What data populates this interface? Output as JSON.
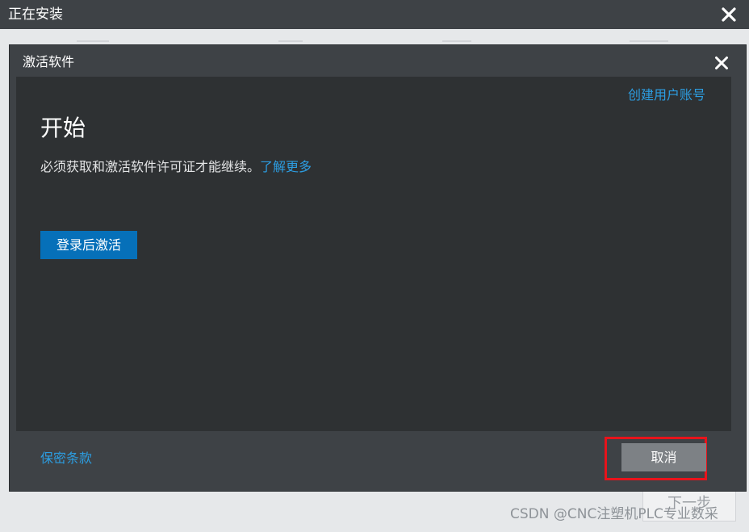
{
  "outer_window": {
    "title": "正在安装",
    "next_button_label": "下一步"
  },
  "dialog": {
    "title": "激活软件",
    "create_account_link": "创建用户账号",
    "heading": "开始",
    "description": "必须获取和激活软件许可证才能继续。",
    "learn_more_link": "了解更多",
    "signin_button_label": "登录后激活",
    "privacy_link": "保密条款",
    "cancel_button_label": "取消"
  },
  "watermark": "CSDN @CNC注塑机PLC专业数采",
  "colors": {
    "accent_link": "#2c9de1",
    "primary_button": "#0670b9",
    "highlight_border": "#e8131b",
    "dialog_background": "#2e3133",
    "title_bar": "#3e4246"
  },
  "icons": {
    "outer_close": "close-icon",
    "dialog_close": "close-icon"
  }
}
